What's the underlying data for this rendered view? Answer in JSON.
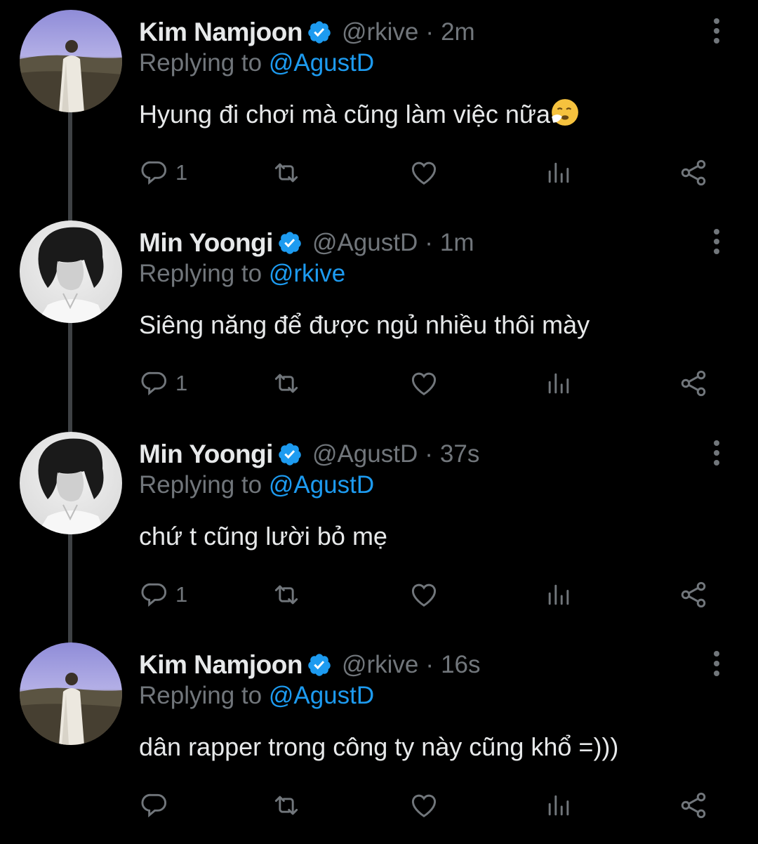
{
  "tweets": [
    {
      "name": "Kim Namjoon",
      "handle": "@rkive",
      "separator": "·",
      "time": "2m",
      "replying_prefix": "Replying to ",
      "replying_to": "@AgustD",
      "text": "Hyung đi chơi mà cũng làm việc nữa",
      "emoji": "sneezing-face-emoji",
      "reply_count": "1",
      "avatar": "kim-namjoon-avatar"
    },
    {
      "name": "Min Yoongi",
      "handle": "@AgustD",
      "separator": "·",
      "time": "1m",
      "replying_prefix": "Replying to ",
      "replying_to": "@rkive",
      "text": "Siêng năng để được ngủ nhiều thôi mày",
      "reply_count": "1",
      "avatar": "min-yoongi-avatar"
    },
    {
      "name": "Min Yoongi",
      "handle": "@AgustD",
      "separator": "·",
      "time": "37s",
      "replying_prefix": "Replying to ",
      "replying_to": "@AgustD",
      "text": "chứ t cũng lười bỏ mẹ",
      "reply_count": "1",
      "avatar": "min-yoongi-avatar"
    },
    {
      "name": "Kim Namjoon",
      "handle": "@rkive",
      "separator": "·",
      "time": "16s",
      "replying_prefix": "Replying to ",
      "replying_to": "@AgustD",
      "text": "dân rapper trong công ty này cũng khổ =)))",
      "reply_count": "",
      "avatar": "kim-namjoon-avatar"
    }
  ],
  "colors": {
    "background": "#000000",
    "text": "#e7e9ea",
    "secondary": "#71767b",
    "accent": "#1d9bf0",
    "thread_line": "#3e4144"
  }
}
